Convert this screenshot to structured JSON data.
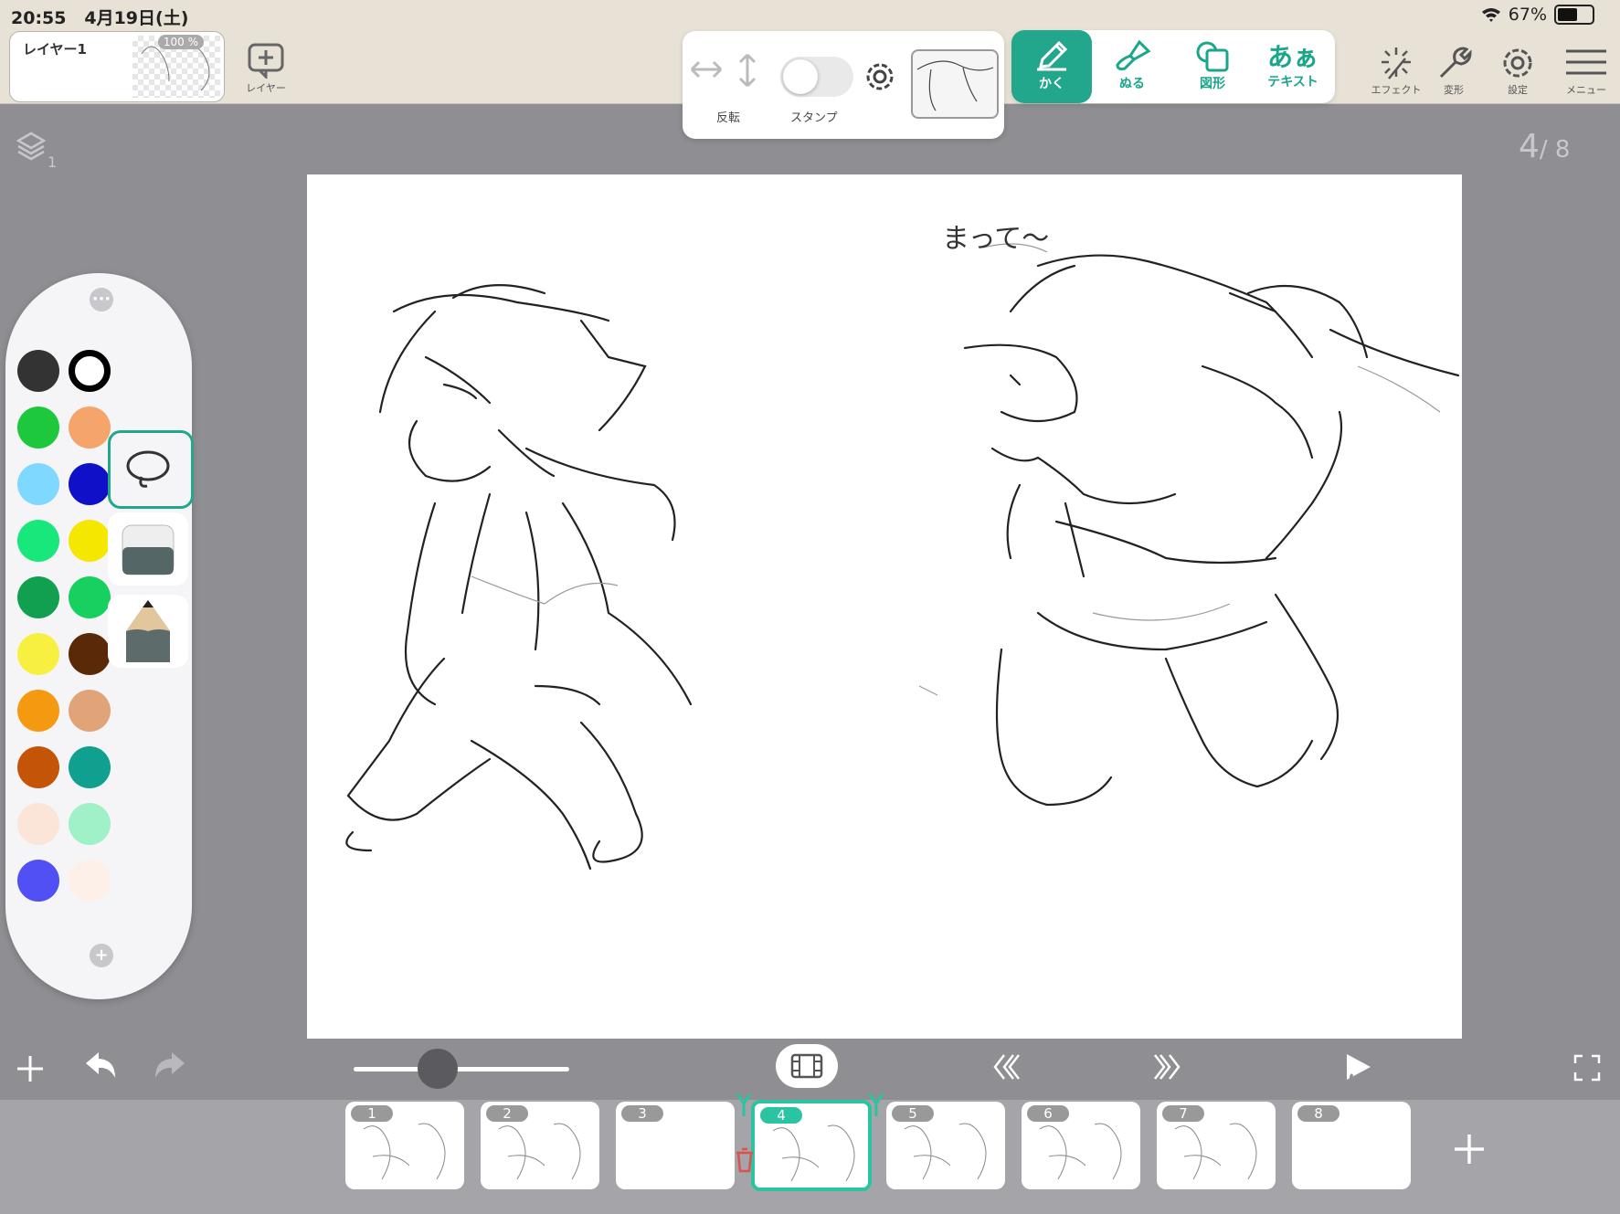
{
  "status": {
    "time": "20:55",
    "date": "4月19日(土)",
    "battery": "67%",
    "battery_level": 0.67
  },
  "layer_panel": {
    "name": "レイヤー1",
    "opacity": "100 %",
    "add_layer_label": "レイヤー"
  },
  "flip_panel": {
    "flip_label": "反転",
    "stamp_label": "スタンプ"
  },
  "modes": [
    {
      "label": "かく",
      "icon": "pencil-icon",
      "active": true
    },
    {
      "label": "ぬる",
      "icon": "brush-icon",
      "active": false
    },
    {
      "label": "図形",
      "icon": "shape-icon",
      "active": false
    },
    {
      "label": "テキスト",
      "icon": "text-icon",
      "active": false,
      "glyph": "あぁ"
    }
  ],
  "right_tools": [
    {
      "label": "エフェクト",
      "icon": "effect-icon"
    },
    {
      "label": "変形",
      "icon": "wrench-icon"
    },
    {
      "label": "設定",
      "icon": "gear-icon"
    },
    {
      "label": "メニュー",
      "icon": "menu-icon"
    }
  ],
  "layer_count": "1",
  "page": {
    "current": "4",
    "total": "/ 8"
  },
  "canvas": {
    "annotation": "まって〜"
  },
  "palette": {
    "colors": [
      "#333333",
      "#ffffff",
      "#1ec83c",
      "#f5a46c",
      "#7fd8ff",
      "#1010c8",
      "#18e87c",
      "#f5e800",
      "#10a050",
      "#18d060",
      "#f8f040",
      "#5a2a08",
      "#f59a10",
      "#e0a478",
      "#c45408",
      "#10a090",
      "#fbe4d8",
      "#a0f0c8",
      "#5050f5",
      "#fdf0e8"
    ]
  },
  "frames": [
    {
      "num": "1"
    },
    {
      "num": "2"
    },
    {
      "num": "3"
    },
    {
      "num": "4",
      "active": true
    },
    {
      "num": "5"
    },
    {
      "num": "6"
    },
    {
      "num": "7"
    },
    {
      "num": "8"
    }
  ],
  "colors": {
    "accent": "#22a68c",
    "topbar": "#e8e2d6",
    "workspace": "#8e8e93"
  }
}
